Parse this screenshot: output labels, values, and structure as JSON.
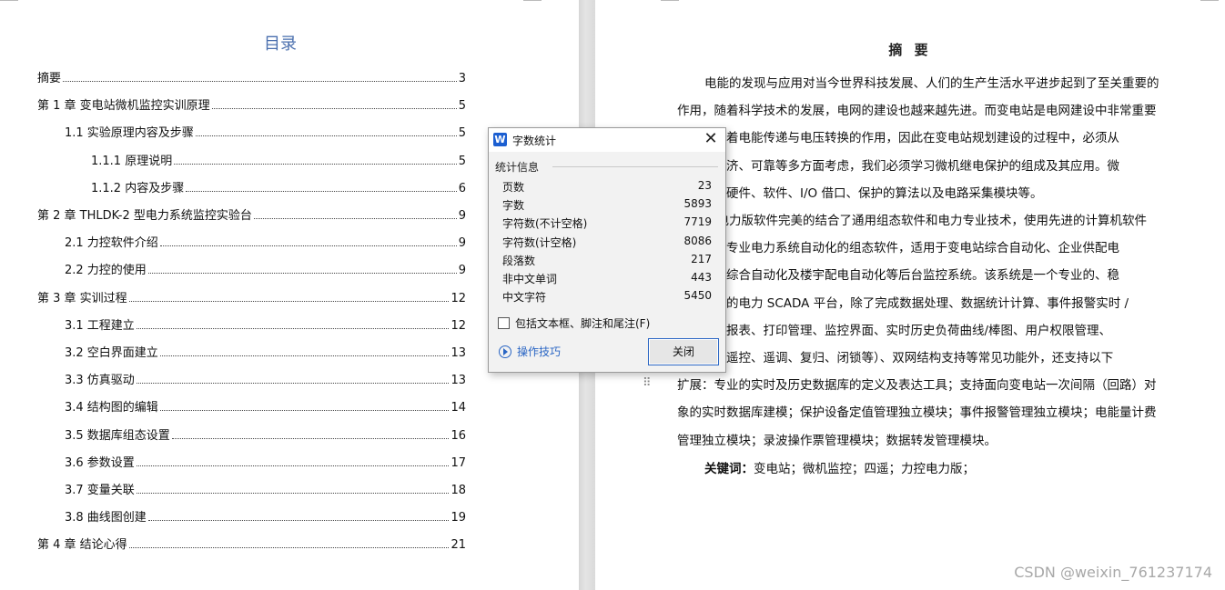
{
  "toc": {
    "title": "目录",
    "entries": [
      {
        "label": "摘要",
        "page": "3"
      },
      {
        "label": "第 1 章  变电站微机监控实训原理",
        "page": "5"
      },
      {
        "label": "1.1  实验原理内容及步骤",
        "page": "5"
      },
      {
        "label": "1.1.1  原理说明",
        "page": "5"
      },
      {
        "label": "1.1.2  内容及步骤",
        "page": "6"
      },
      {
        "label": "第 2 章  THLDK-2  型电力系统监控实验台",
        "page": "9"
      },
      {
        "label": "2.1  力控软件介绍",
        "page": "9"
      },
      {
        "label": "2.2  力控的使用",
        "page": "9"
      },
      {
        "label": "第 3 章  实训过程",
        "page": "12"
      },
      {
        "label": "3.1  工程建立",
        "page": "12"
      },
      {
        "label": "3.2  空白界面建立",
        "page": "13"
      },
      {
        "label": "3.3  仿真驱动",
        "page": "13"
      },
      {
        "label": "3.4  结构图的编辑",
        "page": "14"
      },
      {
        "label": "3.5  数据库组态设置",
        "page": "16"
      },
      {
        "label": "3.6  参数设置",
        "page": "17"
      },
      {
        "label": "3.7  变量关联",
        "page": "18"
      },
      {
        "label": "3.8  曲线图创建",
        "page": "19"
      },
      {
        "label": "第 4 章  结论心得",
        "page": "21"
      }
    ]
  },
  "abstract": {
    "title": "摘 要",
    "lines": [
      "电能的发现与应用对当今世界科技发展、人们的生产生活水平进步起到了至关重要的",
      "作用，随着科学技术的发展，电网的建设也越来越先进。而变电站是电网建设中非常重要",
      "环节，起着电能传递与电压转换的作用，因此在变电站规划建设的过程中，必须从",
      "安全、经济、可靠等多方面考虑，我们必须学习微机继电保护的组成及其应用。微",
      "保护是由硬件、软件、I/O 借口、保护的算法以及电路采集模块等。",
      "变电力版软件完美的结合了通用组态软件和电力专业技术，使用先进的计算机软件",
      "术开发的专业电力系统自动化的组态软件，适用于变电站综合自动化、企业供配电",
      "、水电站综合自动化及楼宇配电自动化等后台监控系统。该系统是一个专业的、稳",
      "的、完善的电力 SCADA 平台，除了完成数据处理、数据统计计算、事件报警实时 /",
      "录、专业报表、打印管理、监控界面、实时历史负荷曲线/棒图、用户权限管理、",
      "作习惯（遥控、遥调、复归、闭锁等）、双网结构支持等常见功能外，还支持以下",
      "扩展：专业的实时及历史数据库的定义及表达工具；支持面向变电站一次间隔（回路）对",
      "象的实时数据库建模；保护设备定值管理独立模块；事件报警管理独立模块；电能量计费",
      "管理独立模块；录波操作票管理模块；数据转发管理模块。"
    ],
    "keywords_label": "关键词：",
    "keywords": "变电站；微机监控；四遥；力控电力版；"
  },
  "dialog": {
    "title": "字数统计",
    "app_icon": "W",
    "group_label": "统计信息",
    "stats": [
      {
        "label": "页数",
        "value": "23"
      },
      {
        "label": "字数",
        "value": "5893"
      },
      {
        "label": "字符数(不计空格)",
        "value": "7719"
      },
      {
        "label": "字符数(计空格)",
        "value": "8086"
      },
      {
        "label": "段落数",
        "value": "217"
      },
      {
        "label": "非中文单词",
        "value": "443"
      },
      {
        "label": "中文字符",
        "value": "5450"
      }
    ],
    "checkbox_label": "包括文本框、脚注和尾注(F)",
    "checkbox_checked": false,
    "tips_label": "操作技巧",
    "close_button": "关闭",
    "close_icon": "close-icon"
  },
  "watermark": "CSDN @weixin_761237174",
  "colors": {
    "toc_title": "#4a6fae",
    "link": "#2b66c4",
    "app_icon": "#1c5fd1"
  }
}
